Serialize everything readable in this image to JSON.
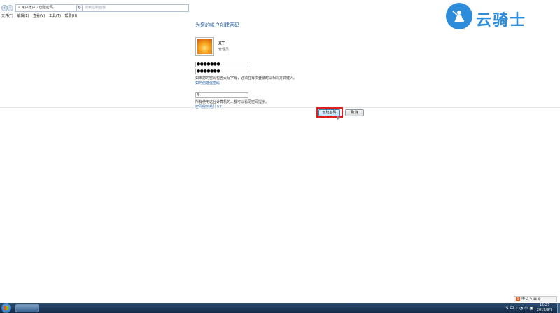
{
  "address": {
    "back_icon": "back-arrow-icon",
    "forward_icon": "forward-arrow-icon",
    "breadcrumb": "« 用户帐户 › 创建密码",
    "refresh_icon": "refresh-icon",
    "search_placeholder": "搜索控制面板"
  },
  "menu": [
    "文件(F)",
    "编辑(E)",
    "查看(V)",
    "工具(T)",
    "帮助(H)"
  ],
  "form": {
    "title": "为您的帐户创建密码",
    "username": "XT",
    "usertype": "管理员",
    "password1": "●●●●●●●",
    "password2": "●●●●●●●",
    "case_note": "如果您的密码包含大写字母，必须在每次登录时以相同方式键入。",
    "strong_link": "如何创建强密码",
    "hint_value": "4",
    "hint_note": "所有使用这台计算机的人都可以看见密码提示。",
    "hint_link": "密码提示是什么?",
    "create_button": "创建密码",
    "cancel_button": "取消"
  },
  "watermark": {
    "text": "云骑士",
    "icon": "knight-logo-icon",
    "color": "#2e8ddb"
  },
  "taskbar": {
    "start_icon": "windows-start-icon",
    "tray_text": "S 中 ♪ ◔ ⚇ ▣",
    "time": "15:27",
    "date": "2019/9/7"
  },
  "ime": {
    "logo": "S",
    "text": "中 ♪ ✎ ▦ ⚙"
  },
  "colors": {
    "title": "#1e5494",
    "link": "#1a5aa8",
    "highlight": "#e02020"
  }
}
